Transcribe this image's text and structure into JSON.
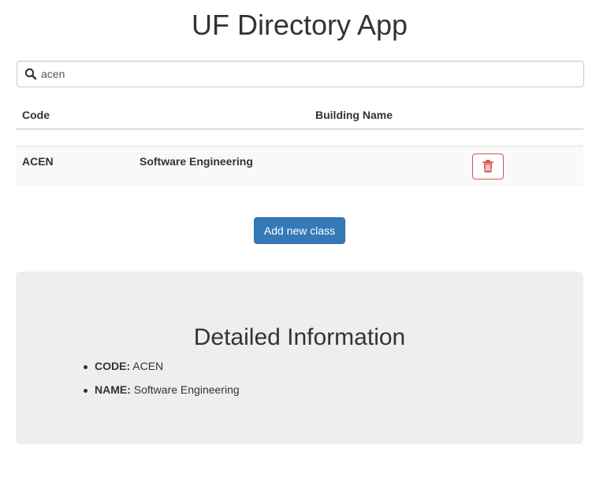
{
  "app": {
    "title": "UF Directory App"
  },
  "search": {
    "value": "acen",
    "icon": "search-icon"
  },
  "table": {
    "headers": {
      "code": "Code",
      "building_name": "Building Name"
    },
    "rows": [
      {
        "code": "ACEN",
        "name": "Software Engineering",
        "delete_icon": "trash-icon"
      }
    ]
  },
  "actions": {
    "add_label": "Add new class"
  },
  "detail": {
    "title": "Detailed Information",
    "items": [
      {
        "key": "CODE:",
        "value": " ACEN"
      },
      {
        "key": "NAME:",
        "value": " Software Engineering"
      }
    ]
  },
  "colors": {
    "primary": "#337ab7",
    "danger": "#d9534f",
    "panel_bg": "#eeeeee",
    "row_stripe": "#f9f9f9"
  }
}
